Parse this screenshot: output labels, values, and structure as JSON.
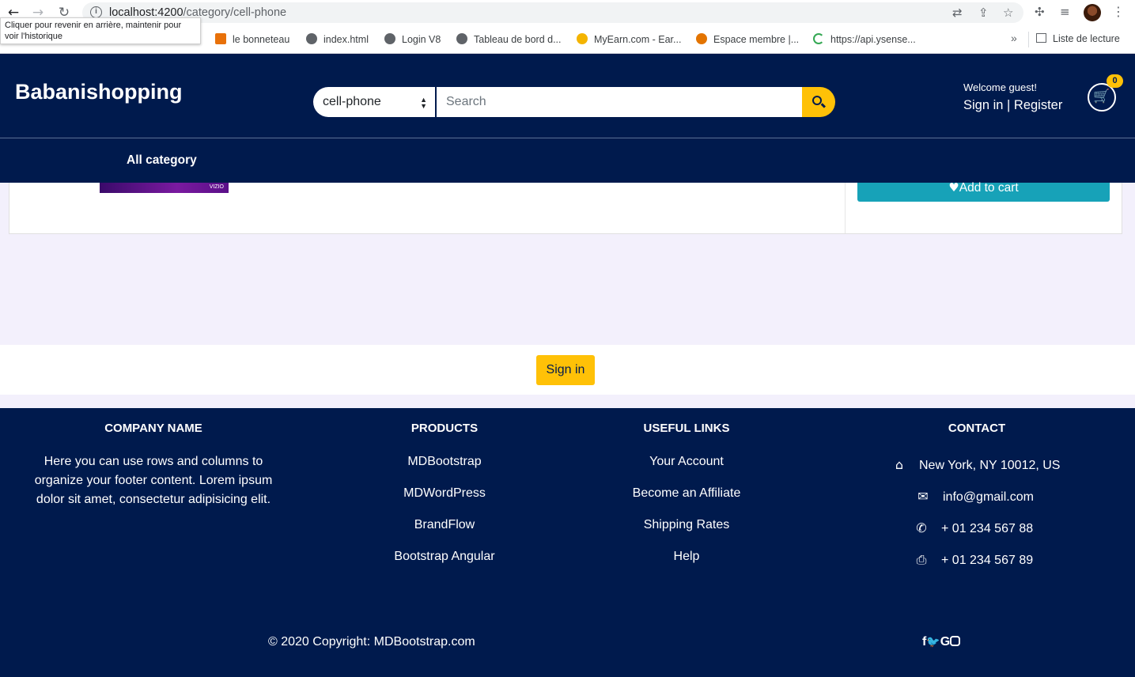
{
  "browser": {
    "url_host": "localhost:4200",
    "url_path": "/category/cell-phone",
    "tooltip": "Cliquer pour revenir en arrière, maintenir pour voir l'historique",
    "bookmarks": [
      {
        "label": "le bonneteau",
        "color": "#e8710a"
      },
      {
        "label": "index.html",
        "color": "#5f6368"
      },
      {
        "label": "Login V8",
        "color": "#5f6368"
      },
      {
        "label": "Tableau de bord d...",
        "color": "#5f6368"
      },
      {
        "label": "MyEarn.com - Ear...",
        "color": "#f4b400"
      },
      {
        "label": "Espace membre |...",
        "color": "#e37400"
      },
      {
        "label": "https://api.ysense...",
        "color": "#34a853"
      }
    ],
    "more": "»",
    "reading_list": "Liste de lecture"
  },
  "header": {
    "brand": "Babanishopping",
    "category_selected": "cell-phone",
    "search_placeholder": "Search",
    "welcome": "Welcome guest!",
    "auth": "Sign in | Register",
    "cart_count": "0",
    "cart_icon": "shopping-cart-icon",
    "search_icon": "search-icon"
  },
  "nav": {
    "all_category": "All category"
  },
  "product": {
    "thumb_brand": "VIZIO",
    "add_to_cart": "Add to cart"
  },
  "signin": {
    "label": "Sign in"
  },
  "footer": {
    "company": {
      "heading": "COMPANY NAME",
      "text": "Here you can use rows and columns to organize your footer content. Lorem ipsum dolor sit amet, consectetur adipisicing elit."
    },
    "products": {
      "heading": "PRODUCTS",
      "items": [
        "MDBootstrap",
        "MDWordPress",
        "BrandFlow",
        "Bootstrap Angular"
      ]
    },
    "links": {
      "heading": "USEFUL LINKS",
      "items": [
        "Your Account",
        "Become an Affiliate",
        "Shipping Rates",
        "Help"
      ]
    },
    "contact": {
      "heading": "CONTACT",
      "address": "New York, NY 10012, US",
      "email": "info@gmail.com",
      "phone": "+ 01 234 567 88",
      "fax": "+ 01 234 567 89"
    },
    "copyright": "© 2020 Copyright: MDBootstrap.com"
  },
  "colors": {
    "navy": "#001a4d",
    "accent": "#ffc107",
    "teal": "#17a2b8",
    "page_bg": "#f3f0fc"
  }
}
